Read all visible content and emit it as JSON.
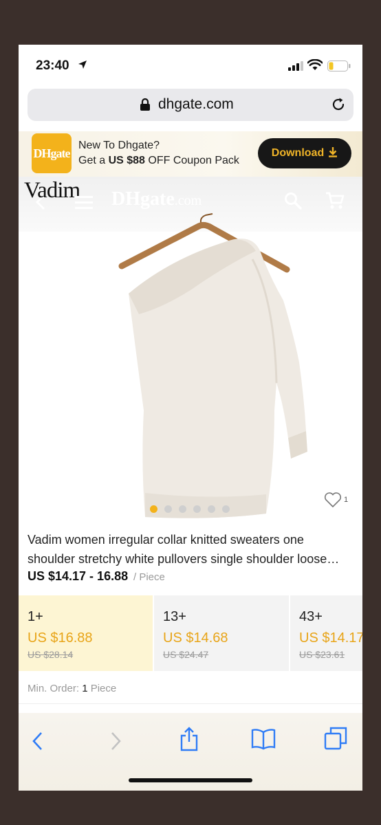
{
  "status": {
    "time": "23:40"
  },
  "browser": {
    "url": "dhgate.com"
  },
  "banner": {
    "logo_text": "DHgate",
    "line1": "New To Dhgate?",
    "line2_prefix": "Get a ",
    "line2_bold": "US $88",
    "line2_suffix": " OFF Coupon Pack",
    "download_label": "Download"
  },
  "nav": {
    "brand": "Vadim",
    "logo_main": "DHgate",
    "logo_suffix": ".com"
  },
  "product": {
    "title_line1": "Vadim women irregular collar knitted sweaters one",
    "title_line2": "shoulder stretchy white pullovers single shoulder loose…",
    "price_range": "US $14.17 - 16.88",
    "unit": "/ Piece",
    "favorites": "1",
    "image_count": 6,
    "active_image": 0
  },
  "tiers": [
    {
      "qty": "1+",
      "price": "US $16.88",
      "old": "US $28.14"
    },
    {
      "qty": "13+",
      "price": "US $14.68",
      "old": "US $24.47"
    },
    {
      "qty": "43+",
      "price": "US $14.17",
      "old": "US $23.61"
    }
  ],
  "min_order": {
    "label": "Min. Order:",
    "value": "1",
    "unit": "Piece"
  },
  "colors": {
    "accent": "#f3b21b",
    "price": "#e8a417",
    "selected_tier_bg": "#fdf5d3"
  },
  "icons": [
    "location-arrow-icon",
    "signal-icon",
    "wifi-icon",
    "battery-icon",
    "lock-icon",
    "reload-icon",
    "download-icon",
    "back-icon",
    "menu-icon",
    "search-icon",
    "cart-icon",
    "heart-icon",
    "share-icon",
    "bookmarks-icon",
    "tabs-icon"
  ]
}
